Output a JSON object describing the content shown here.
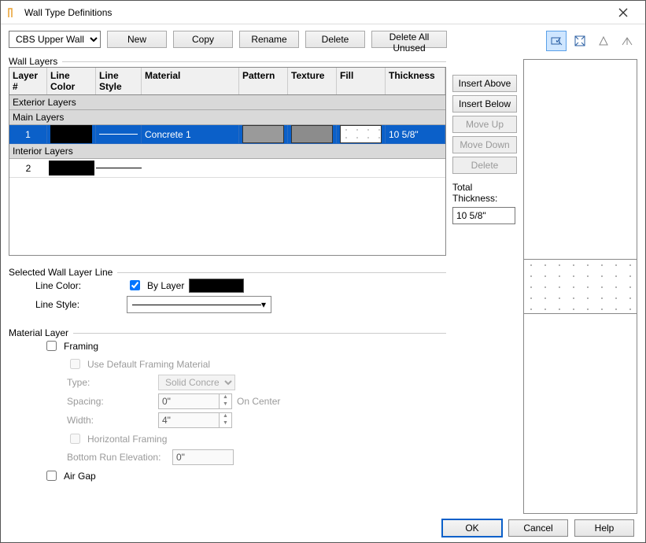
{
  "window": {
    "title": "Wall Type Definitions"
  },
  "topbar": {
    "wall_type": "CBS Upper Wall",
    "new": "New",
    "copy": "Copy",
    "rename": "Rename",
    "delete": "Delete",
    "delete_unused": "Delete All Unused"
  },
  "wall_layers": {
    "section_label": "Wall Layers",
    "headers": {
      "layer": "Layer #",
      "line_color": "Line Color",
      "line_style": "Line Style",
      "material": "Material",
      "pattern": "Pattern",
      "texture": "Texture",
      "fill": "Fill",
      "thickness": "Thickness"
    },
    "groups": {
      "exterior": "Exterior Layers",
      "main": "Main Layers",
      "interior": "Interior Layers"
    },
    "rows": {
      "r1": {
        "num": "1",
        "material": "Concrete 1",
        "thickness": "10 5/8\""
      },
      "r2": {
        "num": "2"
      }
    }
  },
  "side_buttons": {
    "insert_above": "Insert Above",
    "insert_below": "Insert Below",
    "move_up": "Move Up",
    "move_down": "Move Down",
    "delete": "Delete"
  },
  "total_thickness": {
    "label": "Total Thickness:",
    "value": "10 5/8\""
  },
  "selected_line": {
    "section_label": "Selected Wall Layer Line",
    "line_color_label": "Line Color:",
    "by_layer": "By Layer",
    "line_style_label": "Line Style:"
  },
  "material_layer": {
    "section_label": "Material Layer",
    "framing": "Framing",
    "use_default": "Use Default Framing Material",
    "type_label": "Type:",
    "type_value": "Solid Concrete",
    "spacing_label": "Spacing:",
    "spacing_value": "0\"",
    "on_center": "On Center",
    "width_label": "Width:",
    "width_value": "4\"",
    "horizontal_framing": "Horizontal Framing",
    "bottom_run_label": "Bottom Run Elevation:",
    "bottom_run_value": "0\"",
    "air_gap": "Air Gap"
  },
  "toolbar_icons": {
    "a": "object-select-icon",
    "b": "fullscreen-icon",
    "c": "toggle-view-icon",
    "d": "orientation-icon"
  },
  "dialog_buttons": {
    "ok": "OK",
    "cancel": "Cancel",
    "help": "Help"
  }
}
